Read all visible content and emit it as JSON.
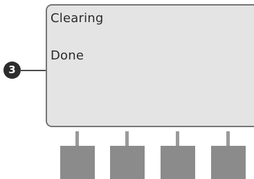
{
  "display": {
    "line1": "Clearing",
    "line2": "Done"
  },
  "callout": {
    "number": "3"
  },
  "colors": {
    "screen": "#e4e4e4",
    "screen_border": "#757575",
    "soft_key": "#8b8b8b",
    "badge": "#2c2c2c"
  }
}
